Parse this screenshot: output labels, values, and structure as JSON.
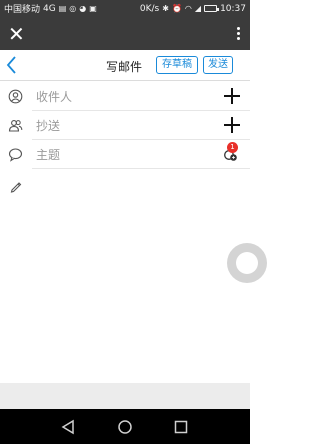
{
  "status_bar": {
    "carrier": "中国移动",
    "network": "4G",
    "speed": "0K/s",
    "battery": "",
    "time": "10:37"
  },
  "browser": {
    "close_icon": "close-icon",
    "more_icon": "more-vertical-icon"
  },
  "nav": {
    "back_icon": "chevron-left-icon",
    "title": "写邮件",
    "draft_label": "存草稿",
    "send_label": "发送"
  },
  "compose": {
    "recipient_placeholder": "收件人",
    "cc_placeholder": "抄送",
    "subject_placeholder": "主题",
    "body_placeholder": "",
    "attachment_count": "1"
  },
  "colors": {
    "accent": "#1a8ad9",
    "badge": "#e8302a",
    "status_bar_bg": "#3b3b3b"
  }
}
